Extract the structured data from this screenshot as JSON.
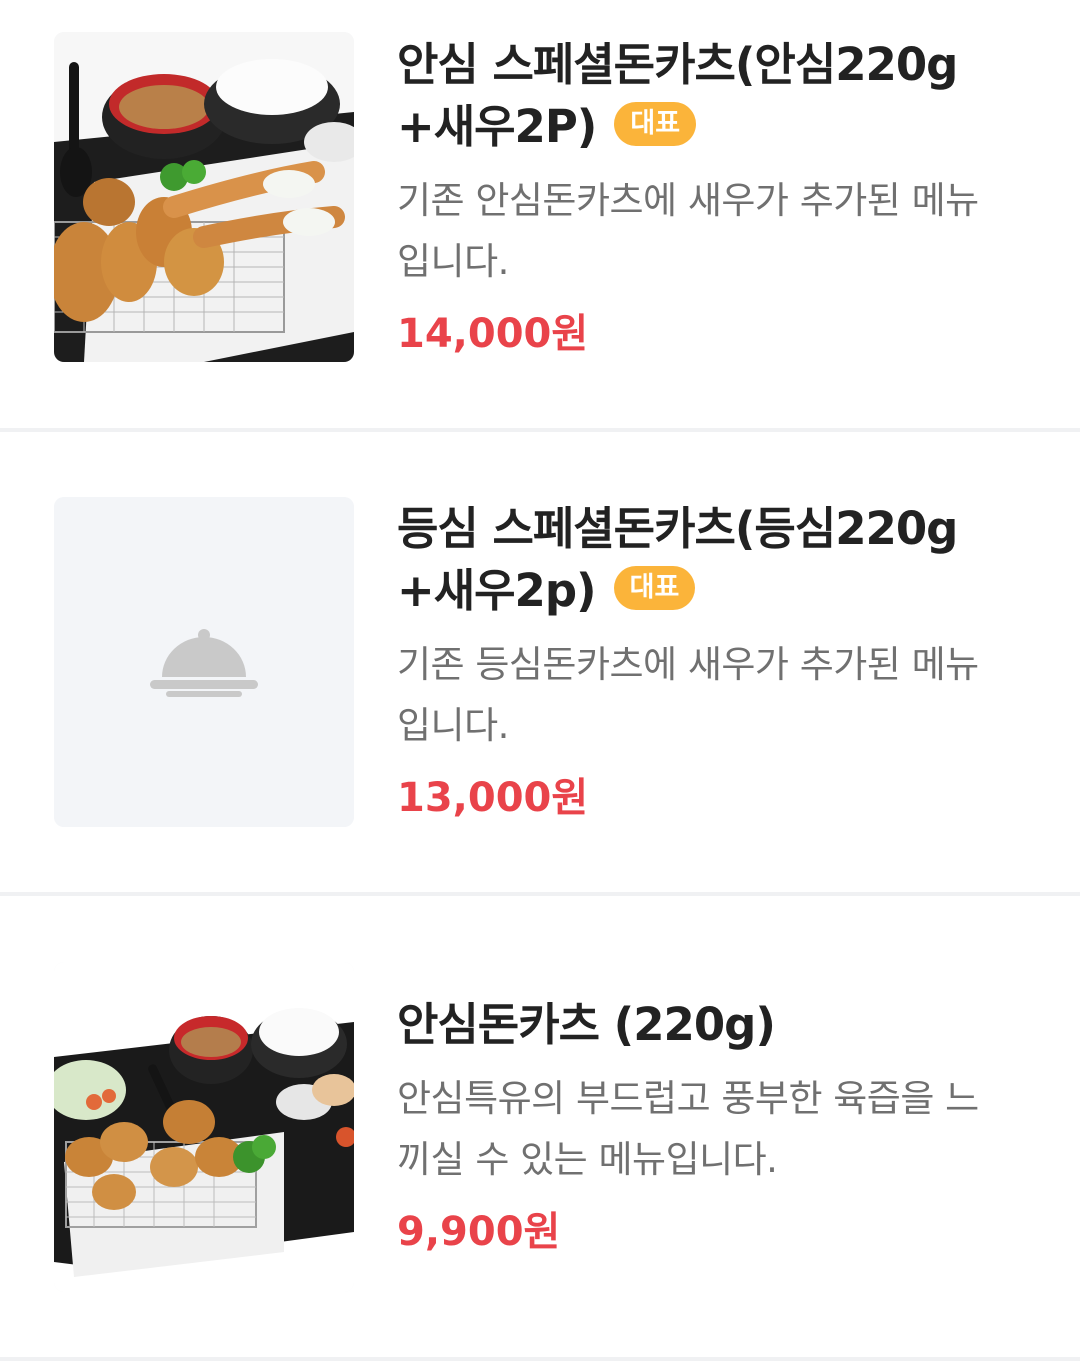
{
  "menu": {
    "items": [
      {
        "title_line1": "안심 스페셜돈카츠(안심220g",
        "title_line2": "+새우2P)",
        "badge": "대표",
        "desc_line1": "기존 안심돈카츠에 새우가 추가된 메뉴",
        "desc_line2": "입니다.",
        "price": "14,000원",
        "image": "food-photo-tonkatsu-shrimp-set"
      },
      {
        "title_line1": "등심 스페셜돈카츠(등심220g",
        "title_line2": "+새우2p)",
        "badge": "대표",
        "desc_line1": "기존 등심돈카츠에 새우가 추가된 메뉴",
        "desc_line2": "입니다.",
        "price": "13,000원",
        "image": "cloche-placeholder-icon"
      },
      {
        "title_line1": "안심돈카츠 (220g)",
        "desc_line1": "안심특유의 부드럽고 풍부한 육즙을 느",
        "desc_line2": "끼실 수 있는 메뉴입니다.",
        "price": "9,900원",
        "image": "food-photo-tonkatsu-set"
      }
    ]
  },
  "colors": {
    "title": "#222222",
    "description": "#707070",
    "price": "#e9434a",
    "badge_bg": "#fbb43a",
    "placeholder_bg": "#f3f5f8",
    "divider": "#f0f1f3"
  }
}
